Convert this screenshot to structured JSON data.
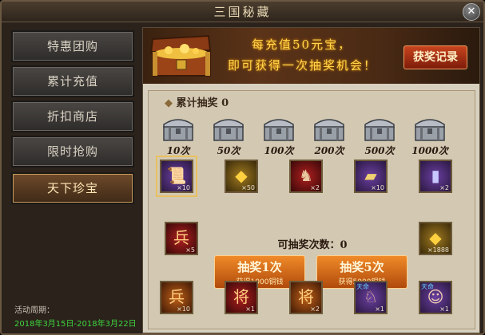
{
  "window": {
    "title": "三国秘藏"
  },
  "sidebar": {
    "items": [
      {
        "label": "特惠团购",
        "active": false
      },
      {
        "label": "累计充值",
        "active": false
      },
      {
        "label": "折扣商店",
        "active": false
      },
      {
        "label": "限时抢购",
        "active": false
      },
      {
        "label": "天下珍宝",
        "active": true
      }
    ],
    "period_label": "活动周期：",
    "period_dates": "2018年3月15日-2018年3月22日"
  },
  "banner": {
    "line1": "每充值50元宝，",
    "line2": "即可获得一次抽奖机会！",
    "record_button": "获奖记录"
  },
  "cumulative": {
    "label": "累计抽奖",
    "value": "0",
    "milestones": [
      "10次",
      "50次",
      "100次",
      "200次",
      "500次",
      "1000次"
    ]
  },
  "rewards_top": [
    {
      "icon": "scroll-bundle-icon",
      "qty": "×10",
      "quality": "purple"
    },
    {
      "icon": "gold-ingot-icon",
      "qty": "×50",
      "quality": "gold"
    },
    {
      "icon": "war-horse-icon",
      "qty": "×2",
      "quality": "red"
    },
    {
      "icon": "token-card-icon",
      "qty": "×10",
      "quality": "purple"
    },
    {
      "icon": "jade-tablet-icon",
      "qty": "×2",
      "quality": "purple"
    }
  ],
  "draws": {
    "remaining_label": "可抽奖次数：",
    "remaining_value": "0",
    "draw1_label": "抽奖1次",
    "draw1_sub": "获得1000铜钱",
    "draw5_label": "抽奖5次",
    "draw5_sub": "获得5000铜钱"
  },
  "rewards_side": [
    {
      "icon": "soldier-token-icon",
      "qty": "×5",
      "quality": "red"
    },
    {
      "icon": "gold-ingot-icon",
      "qty": "×1888",
      "quality": "gold"
    }
  ],
  "rewards_bottom": [
    {
      "icon": "soldier-token-icon",
      "qty": "×10",
      "quality": "orange"
    },
    {
      "icon": "general-token-icon",
      "qty": "×1",
      "quality": "red"
    },
    {
      "icon": "general-token-icon",
      "qty": "×2",
      "quality": "orange"
    },
    {
      "icon": "horse-rider-portrait-icon",
      "qty": "×1",
      "quality": "purple",
      "tag": "天命"
    },
    {
      "icon": "heroine-portrait-icon",
      "qty": "×1",
      "quality": "purple",
      "tag": "天命"
    }
  ]
}
